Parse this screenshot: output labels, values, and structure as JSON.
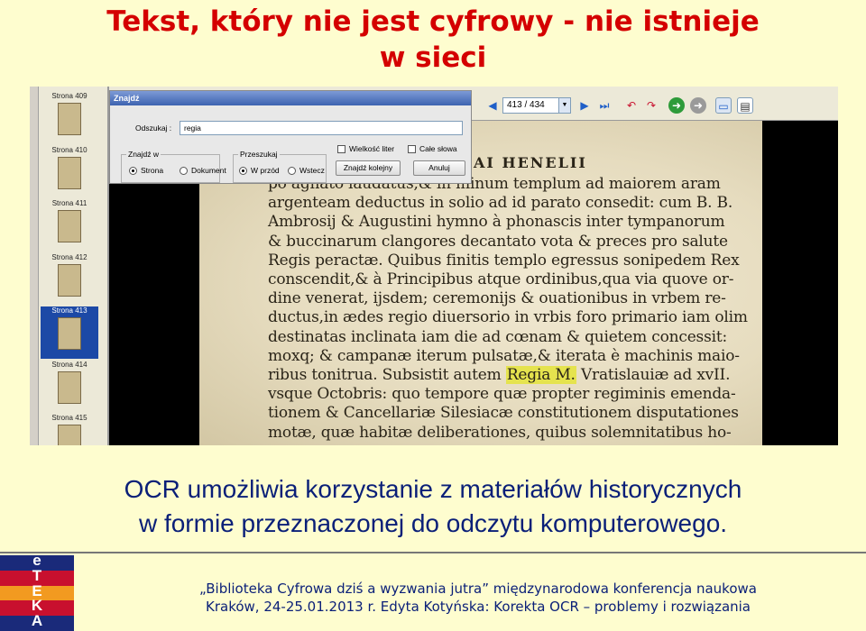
{
  "slide": {
    "title_line1": "Tekst, który nie jest cyfrowy - nie istnieje",
    "title_line2": "w sieci",
    "caption_line1": "OCR umożliwia korzystanie z materiałów historycznych",
    "caption_line2": "w formie przeznaczonej do odczytu komputerowego.",
    "footer_line1": "„Biblioteka Cyfrowa dziś a wyzwania jutra” międzynarodowa konferencja naukowa",
    "footer_line2": "Kraków, 24-25.01.2013 r. Edyta Kotyńska: Korekta OCR – problemy i rozwiązania"
  },
  "logo": {
    "letters": [
      "e",
      "T",
      "E",
      "K",
      "A"
    ],
    "colors": [
      "#1a2a7a",
      "#c8102e",
      "#f29a20",
      "#c8102e",
      "#1a2a7a"
    ]
  },
  "viewer": {
    "thumbnails": [
      {
        "label": "Strona 409",
        "active": false
      },
      {
        "label": "Strona 410",
        "active": false
      },
      {
        "label": "Strona 411",
        "active": false
      },
      {
        "label": "Strona 412",
        "active": false
      },
      {
        "label": "Strona 413",
        "active": true
      },
      {
        "label": "Strona 414",
        "active": false
      },
      {
        "label": "Strona 415",
        "active": false
      }
    ],
    "page_indicator": "413 / 434",
    "toolbar_icons": [
      "nav-left-icon",
      "nav-right-icon",
      "last-page-icon",
      "undo-icon",
      "redo-icon",
      "forward-icon",
      "back-icon",
      "window-icon",
      "layout-icon"
    ],
    "find_dialog": {
      "title": "Znajdź",
      "search_label": "Odszukaj :",
      "search_value": "regia",
      "group_where_title": "Znajdź w",
      "where_options": [
        {
          "label": "Strona",
          "selected": true
        },
        {
          "label": "Dokument",
          "selected": false
        }
      ],
      "group_dir_title": "Przeszukaj",
      "dir_options": [
        {
          "label": "W przód",
          "selected": true
        },
        {
          "label": "Wstecz",
          "selected": false
        }
      ],
      "match_case_label": "Wielkość liter",
      "whole_words_label": "Całe słowa",
      "find_next_label": "Znajdź kolejny",
      "cancel_label": "Anuluj"
    },
    "document": {
      "heading": "AI HENELII",
      "lines": [
        "po agnato laudatus,& in minum templum ad maiorem aram",
        "argenteam deductus in solio ad id parato consedit: cum B. B.",
        "Ambrosij & Augustini hymno à phonascis inter tympanorum",
        "& buccinarum clangores decantato vota & preces pro salute",
        "Regis peractæ. Quibus finitis templo egressus sonipedem Rex",
        "conscendit,& à Principibus atque ordinibus,qua via quove or-",
        "dine venerat, ijsdem; ceremonijs & ouationibus in vrbem re-",
        "ductus,in ædes regio diuersorio in vrbis foro primario iam olim",
        "destinatas inclinata iam die ad cœnam & quietem concessit:",
        "moxq; & campanæ iterum pulsatæ,& iterata è machinis maio-",
        "ribus tonitrua. Subsistit autem",
        "vsque Octobris: quo tempore quæ propter regiminis emenda-",
        "tionem & Cancellariæ Silesiacæ constitutionem disputationes",
        "motæ, quæ habitæ deliberationes, quibus solemnitatibus ho-"
      ],
      "highlight": "Regia M.",
      "after_highlight": " Vratislauiæ ad xvII."
    }
  }
}
